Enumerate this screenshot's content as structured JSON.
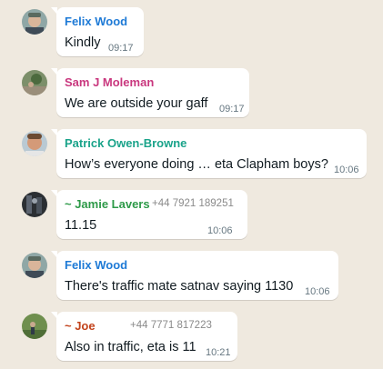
{
  "colors": {
    "wallpaper": "#efe9df",
    "bubble": "#ffffff",
    "felix": "#1e7ad6",
    "sam": "#c9377e",
    "patrick": "#1aa38a",
    "jamie": "#2e9a49",
    "joe": "#c2431c"
  },
  "messages": [
    {
      "sender": "Felix Wood",
      "phone": "",
      "text": "Kindly",
      "time": "09:17",
      "avatar_icon": "felix-avatar"
    },
    {
      "sender": "Sam J Moleman",
      "phone": "",
      "text": "We are outside your gaff",
      "time": "09:17",
      "avatar_icon": "sam-avatar"
    },
    {
      "sender": "Patrick Owen-Browne",
      "phone": "",
      "text": "How’s everyone doing … eta Clapham boys?",
      "time": "10:06",
      "avatar_icon": "patrick-avatar"
    },
    {
      "sender": "~ Jamie Lavers",
      "phone": "+44 7921 189251",
      "text": "11.15",
      "time": "10:06",
      "avatar_icon": "jamie-avatar"
    },
    {
      "sender": "Felix Wood",
      "phone": "",
      "text": "There's traffic mate satnav saying 1130",
      "time": "10:06",
      "avatar_icon": "felix-avatar"
    },
    {
      "sender": "~ Joe",
      "phone": "+44 7771 817223",
      "text": "Also in traffic, eta is 11",
      "time": "10:21",
      "avatar_icon": "joe-avatar"
    }
  ]
}
